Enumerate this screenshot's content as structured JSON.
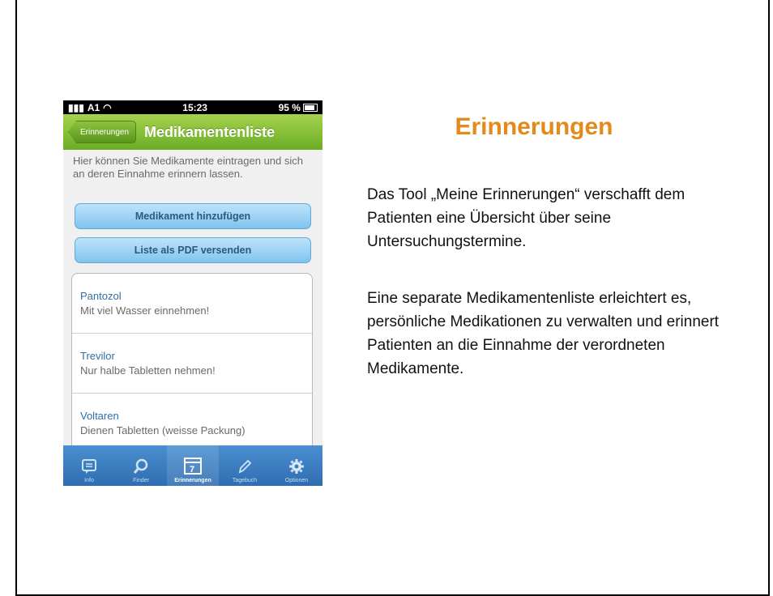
{
  "slide": {
    "title": "Erinnerungen",
    "paragraph1": "Das Tool „Meine Erinnerungen“ verschafft dem Patienten eine Übersicht über seine Untersuchungstermine.",
    "paragraph2": "Eine separate Medikamentenliste erleichtert es, persönliche Medikationen zu verwalten und erinnert Patienten an die Einnahme der verordneten Medikamente.",
    "title_color": "#e38a1a"
  },
  "phone": {
    "status": {
      "carrier": "A1",
      "time": "15:23",
      "battery": "95 %"
    },
    "nav": {
      "back_label": "Erinnerungen",
      "title": "Medikamentenliste",
      "color": "#7ab833"
    },
    "intro": "Hier können Sie Medikamente eintragen und sich an deren Einnahme erinnern lassen.",
    "buttons": {
      "add": "Medikament hinzufügen",
      "pdf": "Liste als PDF versenden"
    },
    "list": [
      {
        "name": "Pantozol",
        "note": "Mit viel Wasser einnehmen!"
      },
      {
        "name": "Trevilor",
        "note": "Nur halbe Tabletten nehmen!"
      },
      {
        "name": "Voltaren",
        "note": "Dienen Tabletten (weisse Packung)"
      }
    ],
    "tabs": [
      {
        "label": "Info",
        "icon": "info-icon"
      },
      {
        "label": "Finder",
        "icon": "search-icon"
      },
      {
        "label": "Erinnerungen",
        "icon": "calendar-icon",
        "active": true
      },
      {
        "label": "Tagebuch",
        "icon": "pencil-icon"
      },
      {
        "label": "Optionen",
        "icon": "gear-icon"
      }
    ]
  }
}
